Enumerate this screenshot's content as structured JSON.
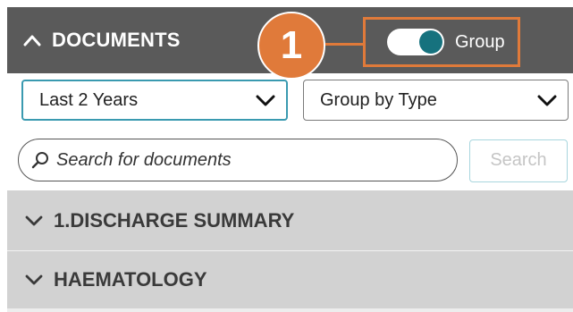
{
  "panel": {
    "title": "DOCUMENTS",
    "collapse_icon": "chevron-up-icon"
  },
  "group_toggle": {
    "label": "Group",
    "checked": true,
    "knob_color": "#16727e"
  },
  "callout": {
    "number": "1",
    "color": "#e07a3a"
  },
  "filters": {
    "time_range": {
      "value": "Last 2 Years",
      "icon": "chevron-down-icon"
    },
    "grouping": {
      "value": "Group by Type",
      "icon": "chevron-down-icon"
    }
  },
  "search": {
    "placeholder": "Search for documents",
    "value": "",
    "icon": "search-icon",
    "button_label": "Search",
    "button_enabled": false
  },
  "groups": [
    {
      "label": "1.DISCHARGE SUMMARY",
      "icon": "chevron-down-icon",
      "expanded": false
    },
    {
      "label": "HAEMATOLOGY",
      "icon": "chevron-down-icon",
      "expanded": false
    }
  ],
  "colors": {
    "header_bg": "#5a5a5a",
    "row_bg": "#d2d2d2",
    "accent_teal": "#3a9ab0"
  }
}
